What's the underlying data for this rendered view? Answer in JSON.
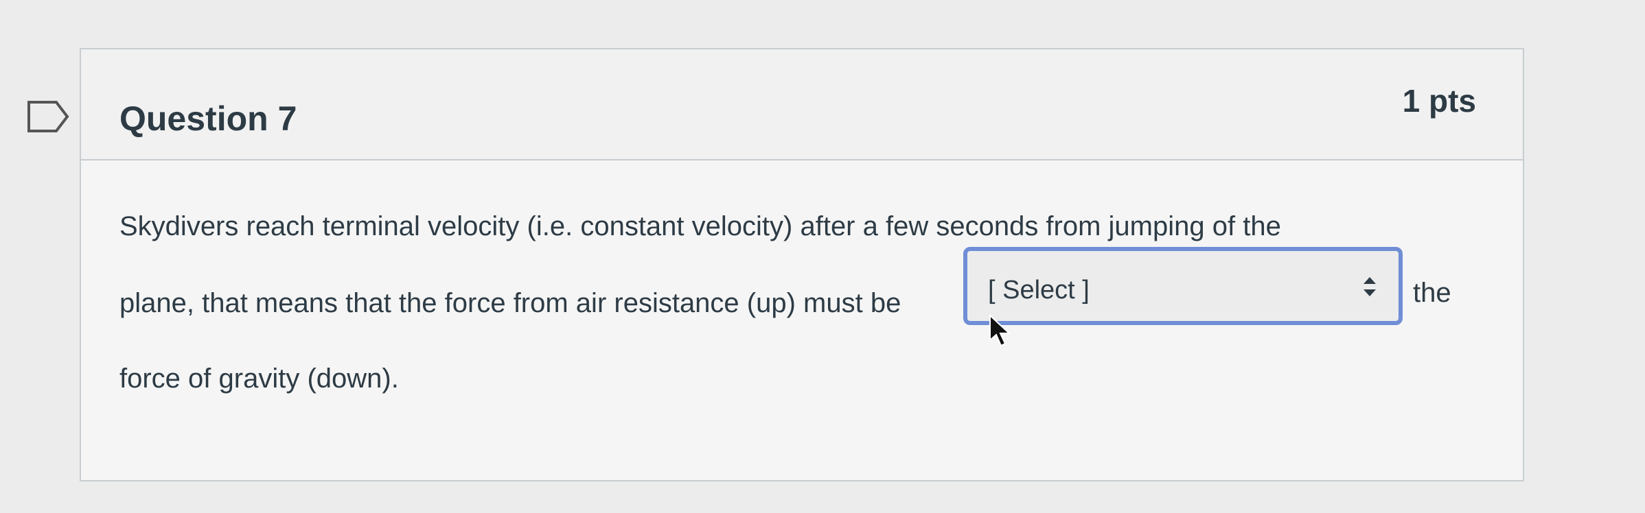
{
  "question": {
    "title": "Question 7",
    "points": "1 pts",
    "text_line_1": "Skydivers reach terminal velocity (i.e. constant velocity) after a few seconds from jumping of the",
    "text_line_2": "plane, that means that the force from air resistance (up) must be",
    "text_after_select": "the",
    "text_line_3": "force of gravity (down).",
    "select": {
      "value": "[ Select ]"
    }
  },
  "icons": {
    "flag": "flag-question-icon",
    "select_arrows": "select-arrows-icon",
    "pointer": "mouse-pointer-icon"
  },
  "colors": {
    "select_focus_border": "#6f8ed6",
    "text": "#2d3b45",
    "card_border": "#c7cdd1"
  }
}
